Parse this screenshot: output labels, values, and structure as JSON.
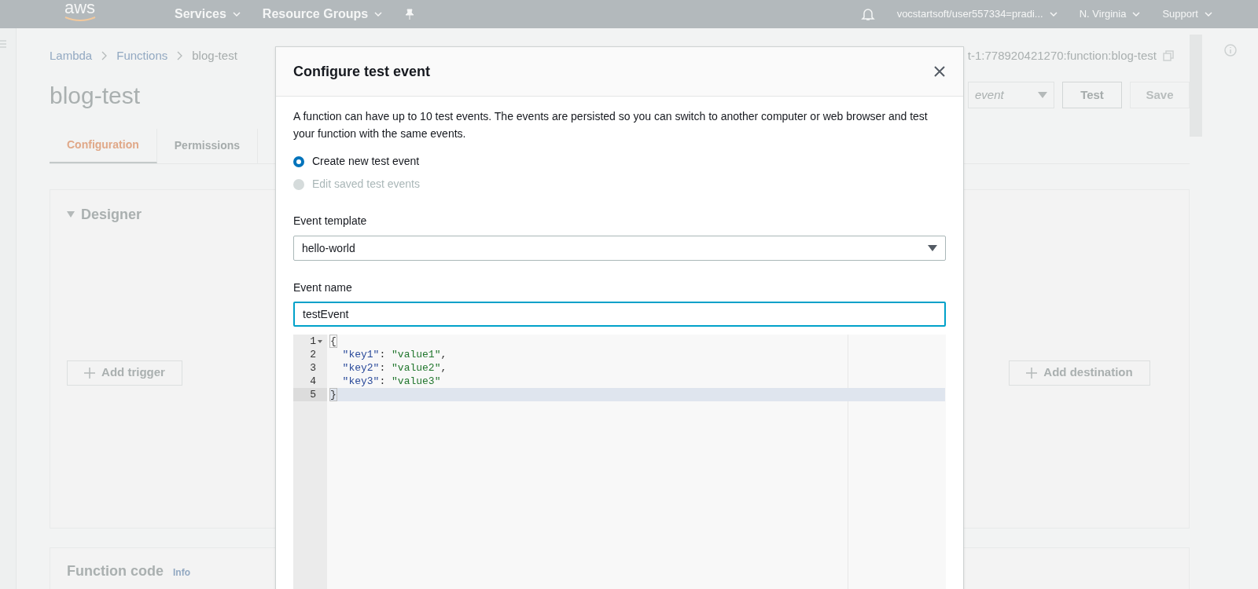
{
  "top_nav": {
    "logo": "aws",
    "services": "Services",
    "resource_groups": "Resource Groups",
    "account": "vocstartsoft/user557334=pradi...",
    "region": "N. Virginia",
    "support": "Support"
  },
  "breadcrumb": [
    "Lambda",
    "Functions",
    "blog-test"
  ],
  "function": {
    "title": "blog-test",
    "arn": "t-1:778920421270:function:blog-test",
    "event_select": "event",
    "buttons": [
      "Test",
      "Save"
    ]
  },
  "tabs": [
    {
      "label": "Configuration",
      "selected": true
    },
    {
      "label": "Permissions",
      "selected": false
    }
  ],
  "designer": {
    "title": "Designer",
    "add_trigger": "Add trigger",
    "add_destination": "Add destination"
  },
  "function_code": {
    "title": "Function code",
    "info": "Info"
  },
  "modal": {
    "title": "Configure test event",
    "description": "A function can have up to 10 test events. The events are persisted so you can switch to another computer or web browser and test your function with the same events.",
    "options": [
      {
        "label": "Create new test event",
        "selected": true,
        "disabled": false
      },
      {
        "label": "Edit saved test events",
        "selected": false,
        "disabled": true
      }
    ],
    "event_template": {
      "label": "Event template",
      "value": "hello-world"
    },
    "event_name": {
      "label": "Event name",
      "value": "testEvent"
    },
    "editor": {
      "lines": [
        {
          "number": "1",
          "foldable": true,
          "highlighted": false,
          "tokens": [
            {
              "kind": "bracket",
              "text": "{"
            }
          ]
        },
        {
          "number": "2",
          "foldable": false,
          "highlighted": false,
          "tokens": [
            {
              "kind": "key",
              "text": "  \"key1\""
            },
            {
              "kind": "punct",
              "text": ": "
            },
            {
              "kind": "string",
              "text": "\"value1\""
            },
            {
              "kind": "punct",
              "text": ","
            }
          ]
        },
        {
          "number": "3",
          "foldable": false,
          "highlighted": false,
          "tokens": [
            {
              "kind": "key",
              "text": "  \"key2\""
            },
            {
              "kind": "punct",
              "text": ": "
            },
            {
              "kind": "string",
              "text": "\"value2\""
            },
            {
              "kind": "punct",
              "text": ","
            }
          ]
        },
        {
          "number": "4",
          "foldable": false,
          "highlighted": false,
          "tokens": [
            {
              "kind": "key",
              "text": "  \"key3\""
            },
            {
              "kind": "punct",
              "text": ": "
            },
            {
              "kind": "string",
              "text": "\"value3\""
            }
          ]
        },
        {
          "number": "5",
          "foldable": false,
          "highlighted": true,
          "tokens": [
            {
              "kind": "bracket",
              "text": "}"
            }
          ]
        }
      ]
    }
  }
}
